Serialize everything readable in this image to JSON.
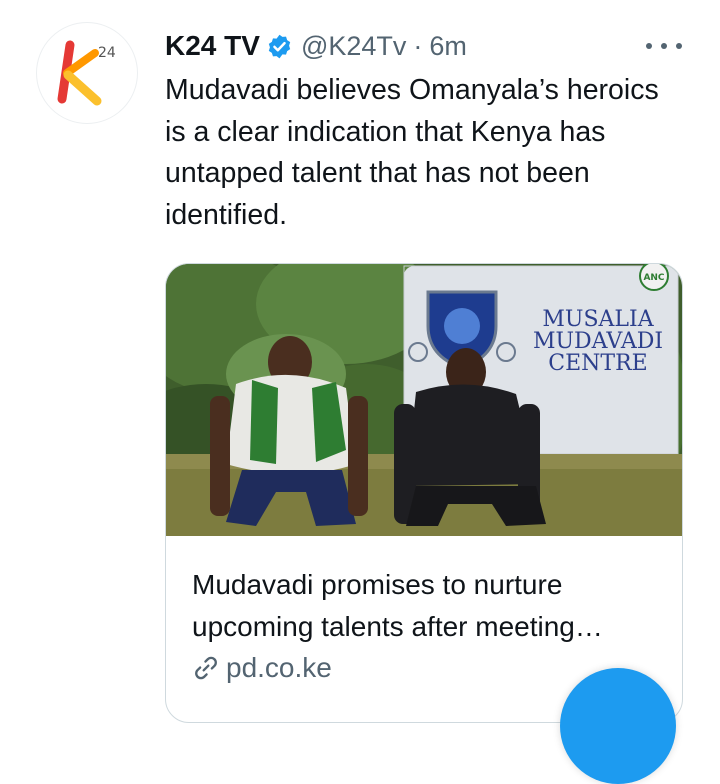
{
  "tweet": {
    "author_name": "K24 TV",
    "handle": "@K24Tv",
    "separator": "·",
    "time": "6m",
    "text": "Mudavadi believes Omanyala’s heroics is a clear indication that Kenya has untapped talent that has not been identified.",
    "avatar_logo": {
      "letter": "k",
      "superscript": "24"
    },
    "verified_badge_color": "#1d9bf0"
  },
  "card": {
    "image_sign": {
      "line1": "MUSALIA",
      "line2": "MUDAVADI",
      "line3": "CENTRE",
      "emblem": "ANC"
    },
    "title": "Mudavadi promises to nurture upcoming talents after meeting Omanyala",
    "domain": "pd.co.ke"
  },
  "colors": {
    "accent": "#1d9bf0",
    "text": "#0f1419",
    "muted": "#536471",
    "border": "#cfd9de"
  },
  "icons": {
    "more": "more-icon",
    "verified": "verified-icon",
    "link": "link-icon",
    "compose": "compose-fab"
  }
}
